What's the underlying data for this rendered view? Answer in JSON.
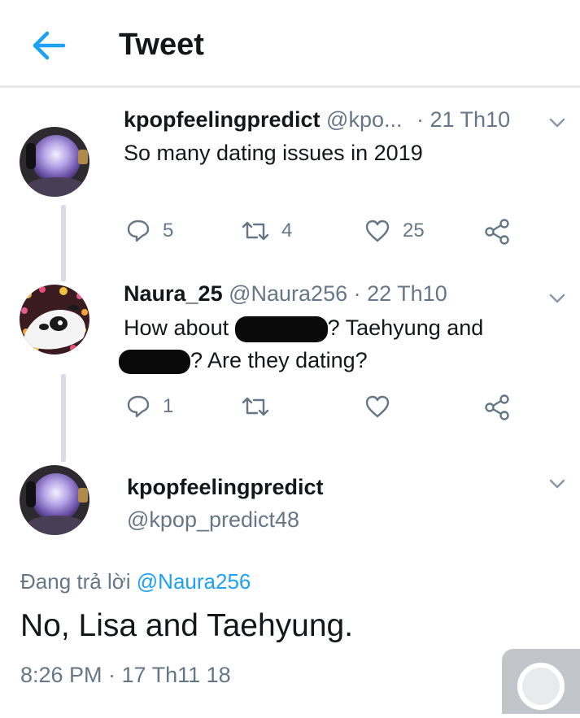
{
  "header": {
    "title": "Tweet",
    "back_icon": "arrow-left-icon",
    "accent": "#1da1f2"
  },
  "tweet1": {
    "display_name": "kpopfeelingpredict",
    "handle": "@kpo...",
    "date": "· 21 Th10",
    "text": "So many dating issues in 2019",
    "actions": {
      "reply_count": "5",
      "retweet_count": "4",
      "like_count": "25"
    }
  },
  "tweet2": {
    "display_name": "Naura_25",
    "handle": "@Naura256",
    "date": "· 22 Th10",
    "text_line1_a": "How about ",
    "text_line1_b": "? Taehyung and",
    "text_line2_b": "? Are they dating?",
    "actions": {
      "reply_count": "1",
      "retweet_count": "",
      "like_count": ""
    }
  },
  "main_tweet": {
    "display_name": "kpopfeelingpredict",
    "handle": "@kpop_predict48",
    "replying_prefix": "Đang trả lời ",
    "replying_handle": "@Naura256",
    "text": "No, Lisa and Taehyung.",
    "timestamp": "8:26 PM · 17 Th11 18"
  }
}
